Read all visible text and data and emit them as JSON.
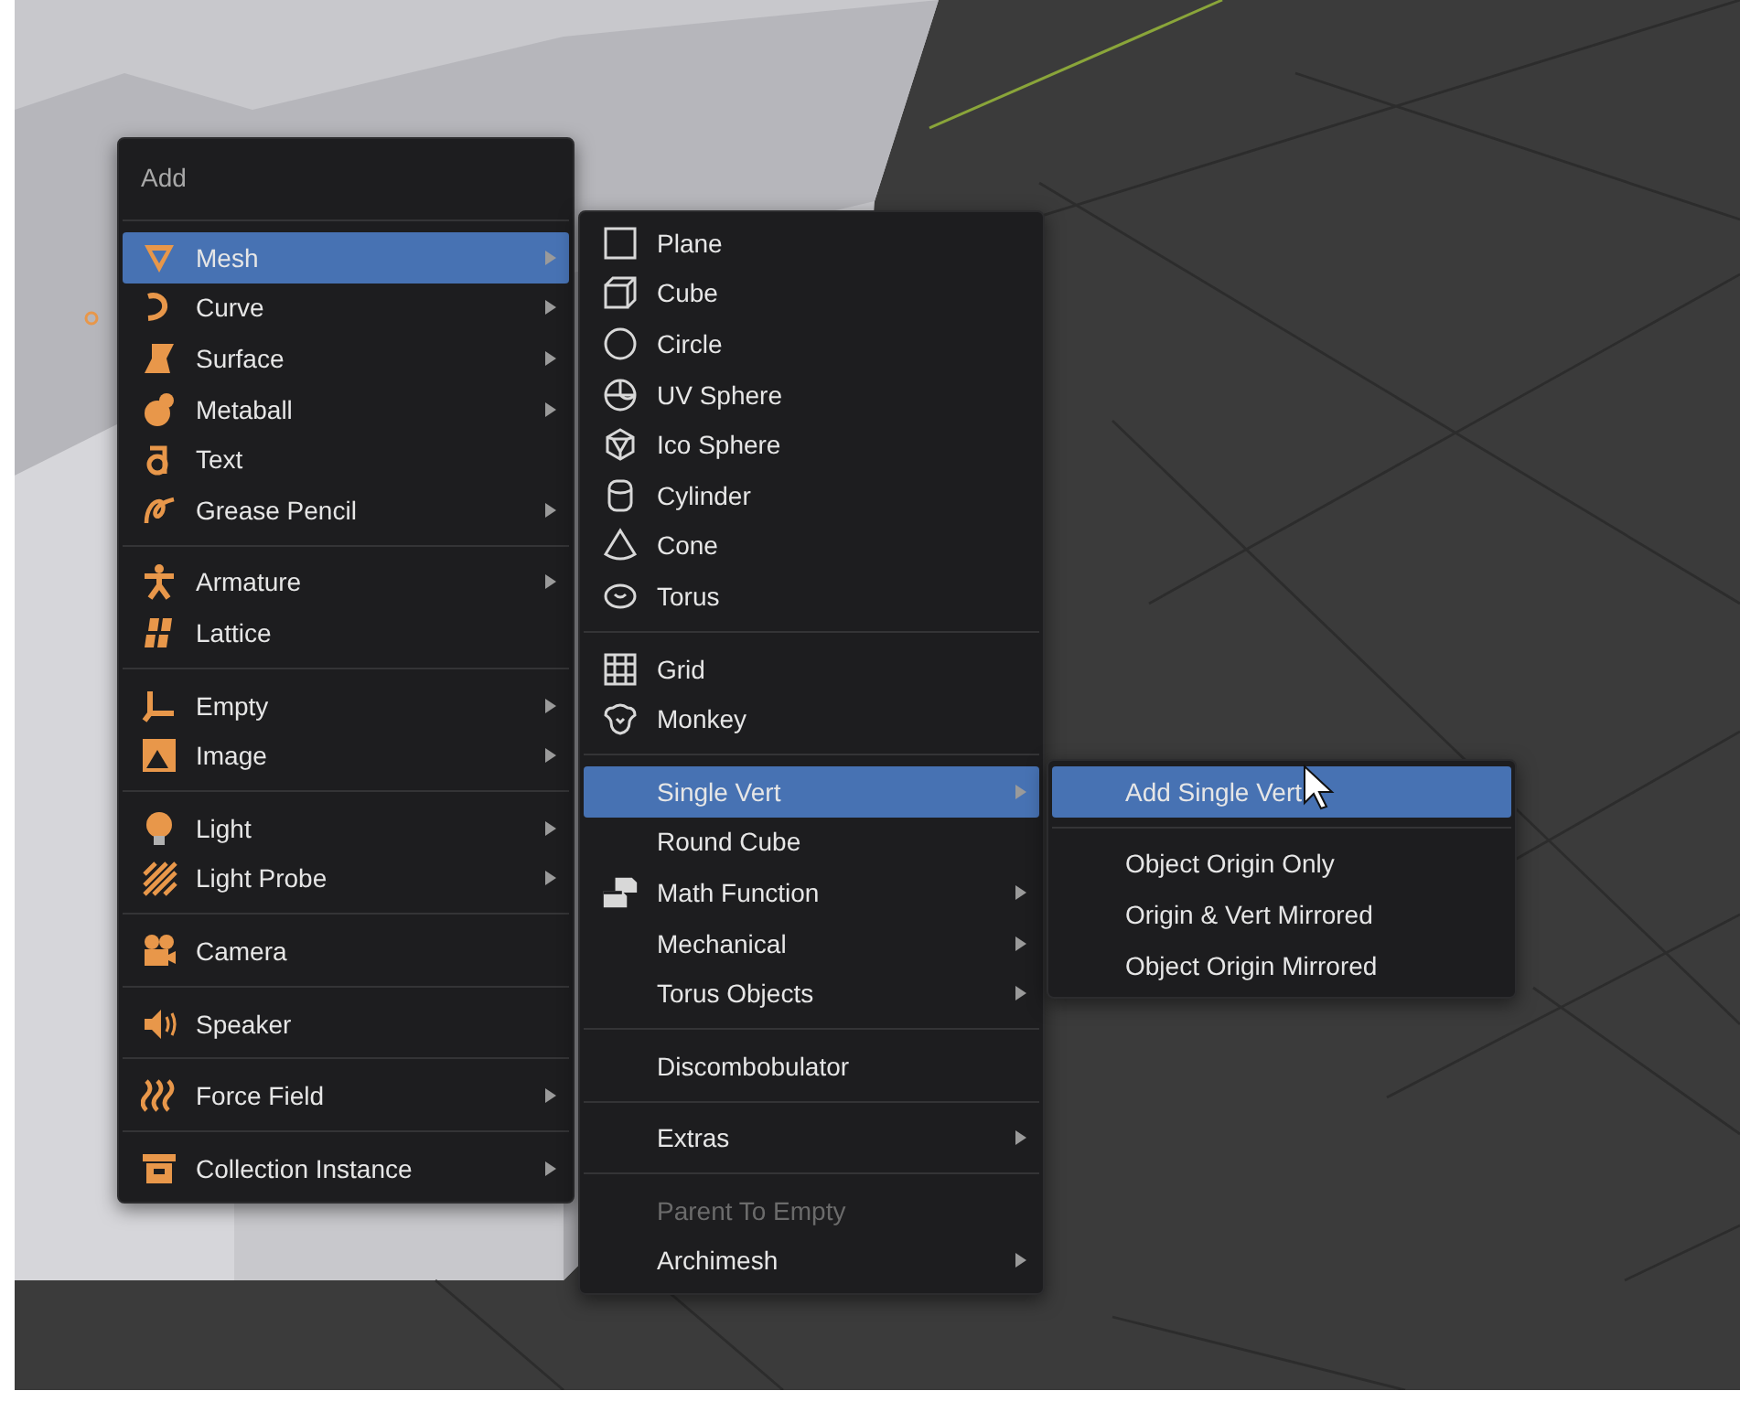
{
  "menus": [
    {
      "title": "Add",
      "groups": [
        [
          {
            "label": "Mesh",
            "selected": true,
            "submenu": true
          },
          {
            "label": "Curve",
            "selected": false,
            "submenu": true
          },
          {
            "label": "Surface",
            "selected": false,
            "submenu": true
          },
          {
            "label": "Metaball",
            "selected": false,
            "submenu": true
          },
          {
            "label": "Text",
            "selected": false,
            "submenu": false
          },
          {
            "label": "Grease Pencil",
            "selected": false,
            "submenu": true
          }
        ],
        [
          {
            "label": "Armature",
            "selected": false,
            "submenu": true
          },
          {
            "label": "Lattice",
            "selected": false,
            "submenu": false
          }
        ],
        [
          {
            "label": "Empty",
            "selected": false,
            "submenu": true
          },
          {
            "label": "Image",
            "selected": false,
            "submenu": true
          }
        ],
        [
          {
            "label": "Light",
            "selected": false,
            "submenu": true
          },
          {
            "label": "Light Probe",
            "selected": false,
            "submenu": true
          }
        ],
        [
          {
            "label": "Camera",
            "selected": false,
            "submenu": false
          }
        ],
        [
          {
            "label": "Speaker",
            "selected": false,
            "submenu": false
          }
        ],
        [
          {
            "label": "Force Field",
            "selected": false,
            "submenu": true
          }
        ],
        [
          {
            "label": "Collection Instance",
            "selected": false,
            "submenu": true
          }
        ]
      ]
    },
    {
      "groups": [
        [
          {
            "label": "Plane",
            "selected": false,
            "submenu": false,
            "disabled": false
          },
          {
            "label": "Cube",
            "selected": false,
            "submenu": false,
            "disabled": false
          },
          {
            "label": "Circle",
            "selected": false,
            "submenu": false,
            "disabled": false
          },
          {
            "label": "UV Sphere",
            "selected": false,
            "submenu": false,
            "disabled": false
          },
          {
            "label": "Ico Sphere",
            "selected": false,
            "submenu": false,
            "disabled": false
          },
          {
            "label": "Cylinder",
            "selected": false,
            "submenu": false,
            "disabled": false
          },
          {
            "label": "Cone",
            "selected": false,
            "submenu": false,
            "disabled": false
          },
          {
            "label": "Torus",
            "selected": false,
            "submenu": false,
            "disabled": false
          }
        ],
        [
          {
            "label": "Grid",
            "selected": false,
            "submenu": false,
            "disabled": false
          },
          {
            "label": "Monkey",
            "selected": false,
            "submenu": false,
            "disabled": false
          }
        ],
        [
          {
            "label": "Single Vert",
            "selected": true,
            "submenu": true,
            "disabled": false
          },
          {
            "label": "Round Cube",
            "selected": false,
            "submenu": false,
            "disabled": false
          },
          {
            "label": "Math Function",
            "selected": false,
            "submenu": true,
            "disabled": false
          },
          {
            "label": "Mechanical",
            "selected": false,
            "submenu": true,
            "disabled": false
          },
          {
            "label": "Torus Objects",
            "selected": false,
            "submenu": true,
            "disabled": false
          }
        ],
        [
          {
            "label": "Discombobulator",
            "selected": false,
            "submenu": false,
            "disabled": false
          }
        ],
        [
          {
            "label": "Extras",
            "selected": false,
            "submenu": true,
            "disabled": false
          }
        ],
        [
          {
            "label": "Parent To Empty",
            "selected": false,
            "submenu": false,
            "disabled": true
          },
          {
            "label": "Archimesh",
            "selected": false,
            "submenu": true,
            "disabled": false
          }
        ]
      ]
    },
    {
      "groups": [
        [
          {
            "label": "Add Single Vert",
            "selected": true,
            "submenu": false
          }
        ],
        [
          {
            "label": "Object Origin Only",
            "selected": false,
            "submenu": false
          },
          {
            "label": "Origin & Vert Mirrored",
            "selected": false,
            "submenu": false
          },
          {
            "label": "Object Origin Mirrored",
            "selected": false,
            "submenu": false
          }
        ]
      ]
    }
  ]
}
